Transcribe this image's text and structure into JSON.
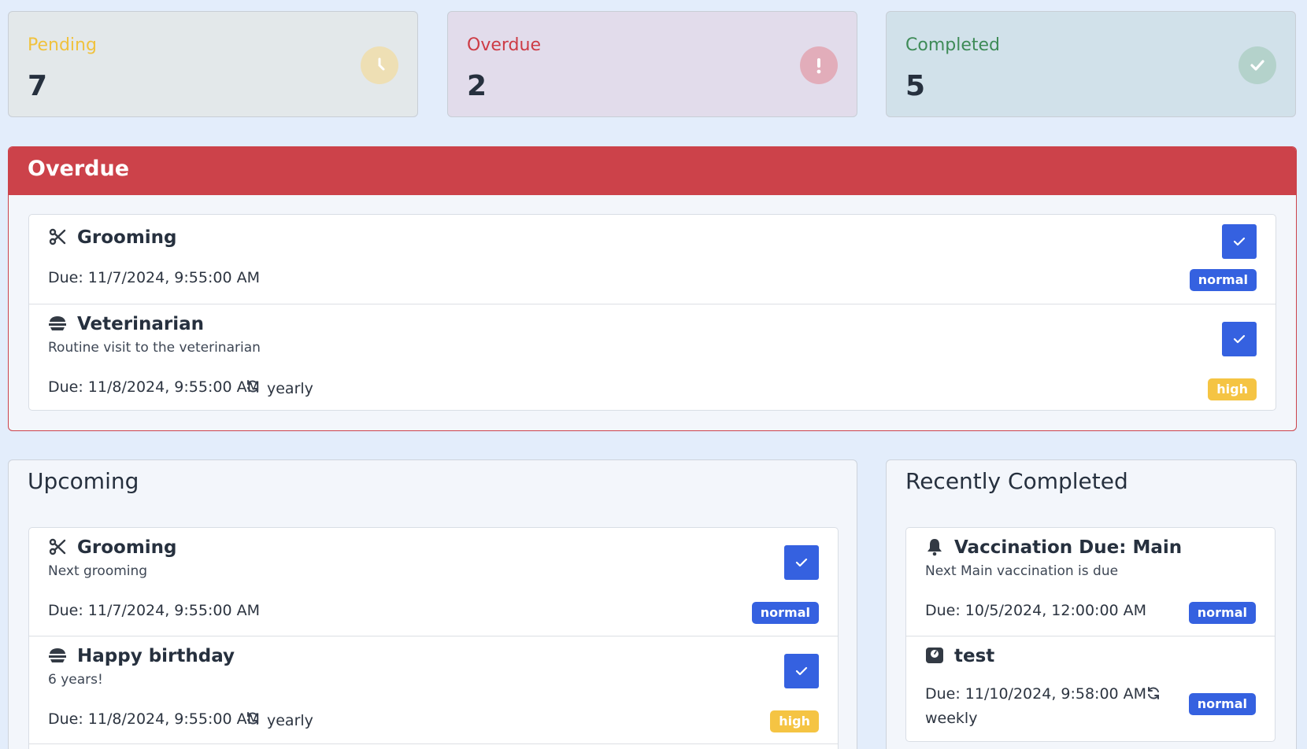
{
  "stats": {
    "pending": {
      "label": "Pending",
      "value": "7",
      "icon": "clock-icon",
      "color": "#f0c23e"
    },
    "overdue": {
      "label": "Overdue",
      "value": "2",
      "icon": "exclamation-icon",
      "color": "#cd3b45"
    },
    "completed": {
      "label": "Completed",
      "value": "5",
      "icon": "check-icon",
      "color": "#3e8b57"
    }
  },
  "overdue_panel": {
    "title": "Overdue",
    "items": [
      {
        "icon": "scissors-icon",
        "title": "Grooming",
        "due": "Due: 11/7/2024, 9:55:00 AM",
        "priority": "normal"
      },
      {
        "icon": "bowl-icon",
        "title": "Veterinarian",
        "description": "Routine visit to the veterinarian",
        "due": "Due: 11/8/2024, 9:55:00 AM",
        "recurrence": "yearly",
        "priority": "high"
      }
    ]
  },
  "upcoming_panel": {
    "title": "Upcoming",
    "items": [
      {
        "icon": "scissors-icon",
        "title": "Grooming",
        "description": "Next grooming",
        "due": "Due: 11/7/2024, 9:55:00 AM",
        "priority": "normal"
      },
      {
        "icon": "bowl-icon",
        "title": "Happy birthday",
        "description": "6 years!",
        "due": "Due: 11/8/2024, 9:55:00 AM",
        "recurrence": "yearly",
        "priority": "high"
      }
    ]
  },
  "completed_panel": {
    "title": "Recently Completed",
    "items": [
      {
        "icon": "bell-icon",
        "title": "Vaccination Due: Main",
        "description": "Next Main vaccination is due",
        "due": "Due: 10/5/2024, 12:00:00 AM",
        "priority": "normal"
      },
      {
        "icon": "scale-icon",
        "title": "test",
        "due": "Due: 11/10/2024, 9:58:00 AM",
        "recurrence": "weekly",
        "priority": "normal"
      }
    ]
  },
  "colors": {
    "background": "#e3edfb",
    "danger": "#cc424a",
    "primary": "#3561e0",
    "warning": "#f5c443"
  }
}
